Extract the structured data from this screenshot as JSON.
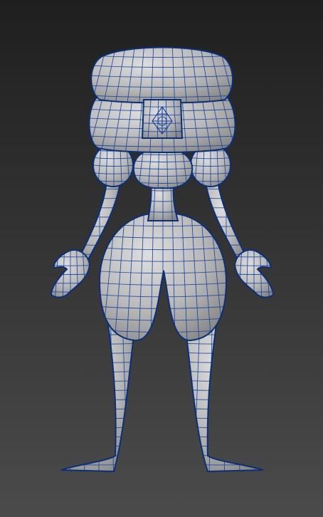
{
  "viewport": {
    "background_top": "#1f1f1f",
    "background_bottom": "#4b4b4b"
  },
  "model": {
    "surface_color": "#b9b9b9",
    "surface_highlight": "#dedede",
    "surface_shadow": "#858585",
    "wire_color": "#17439a",
    "outline_color": "#0b2f78"
  }
}
